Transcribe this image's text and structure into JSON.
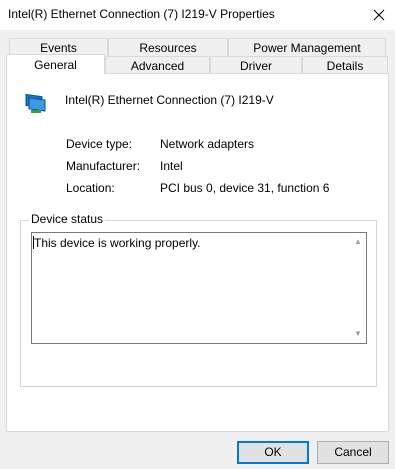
{
  "window": {
    "title": "Intel(R) Ethernet Connection (7) I219-V Properties"
  },
  "tabs": {
    "row1": [
      {
        "label": "Events",
        "selected": false
      },
      {
        "label": "Resources",
        "selected": false
      },
      {
        "label": "Power Management",
        "selected": false
      }
    ],
    "row2": [
      {
        "label": "General",
        "selected": true
      },
      {
        "label": "Advanced",
        "selected": false
      },
      {
        "label": "Driver",
        "selected": false
      },
      {
        "label": "Details",
        "selected": false
      }
    ]
  },
  "device": {
    "name": "Intel(R) Ethernet Connection (7) I219-V",
    "icon": "network-adapter-icon",
    "fields": [
      {
        "label": "Device type:",
        "value": "Network adapters"
      },
      {
        "label": "Manufacturer:",
        "value": "Intel"
      },
      {
        "label": "Location:",
        "value": "PCI bus 0, device 31, function 6"
      }
    ]
  },
  "status": {
    "group_label": "Device status",
    "text": "This device is working properly."
  },
  "buttons": {
    "ok": "OK",
    "cancel": "Cancel"
  },
  "colors": {
    "accent": "#0078d7",
    "panel": "#ffffff",
    "background": "#f0f0f0"
  }
}
